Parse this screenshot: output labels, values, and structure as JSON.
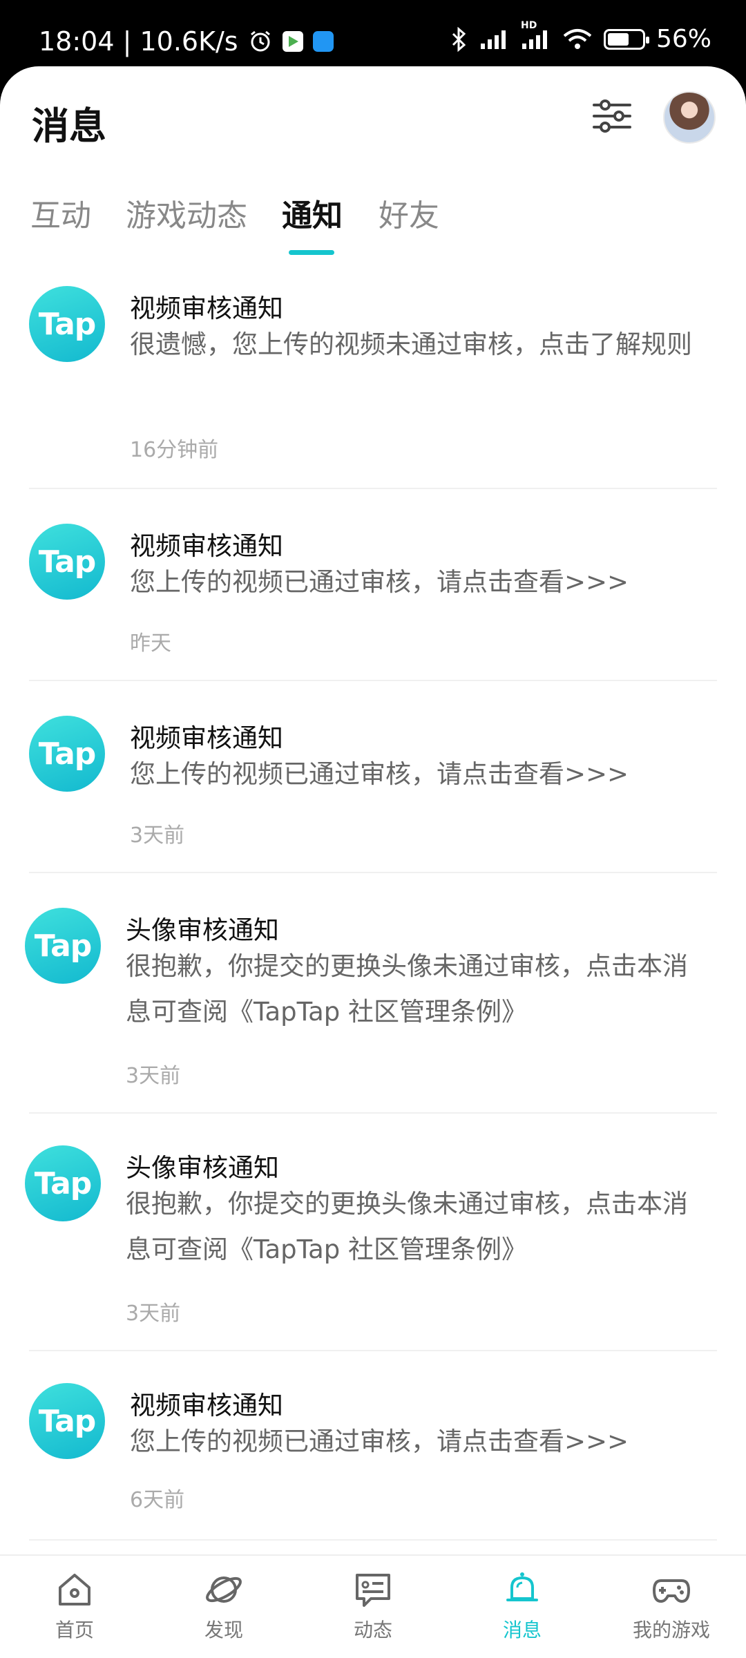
{
  "status_bar": {
    "time_speed": "18:04 | 10.6K/s",
    "network": "HD",
    "battery": "56%"
  },
  "header": {
    "title": "消息"
  },
  "tabs": [
    {
      "label": "互动"
    },
    {
      "label": "游戏动态"
    },
    {
      "label": "通知"
    },
    {
      "label": "好友"
    }
  ],
  "notifications": [
    {
      "logo": "Tap",
      "title": "视频审核通知",
      "body": "很遗憾，您上传的视频未通过审核，点击了解规则",
      "time": "16分钟前"
    },
    {
      "logo": "Tap",
      "title": "视频审核通知",
      "body": "您上传的视频已通过审核，请点击查看>>>",
      "time": "昨天"
    },
    {
      "logo": "Tap",
      "title": "视频审核通知",
      "body": "您上传的视频已通过审核，请点击查看>>>",
      "time": "3天前"
    },
    {
      "logo": "Tap",
      "title": "头像审核通知",
      "body": "很抱歉，你提交的更换头像未通过审核，点击本消息可查阅《TapTap 社区管理条例》",
      "time": "3天前"
    },
    {
      "logo": "Tap",
      "title": "头像审核通知",
      "body": "很抱歉，你提交的更换头像未通过审核，点击本消息可查阅《TapTap 社区管理条例》",
      "time": "3天前"
    },
    {
      "logo": "Tap",
      "title": "视频审核通知",
      "body": "您上传的视频已通过审核，请点击查看>>>",
      "time": "6天前"
    }
  ],
  "bottom_nav": [
    {
      "label": "首页",
      "icon": "home-icon"
    },
    {
      "label": "发现",
      "icon": "planet-icon"
    },
    {
      "label": "动态",
      "icon": "chat-card-icon"
    },
    {
      "label": "消息",
      "icon": "bell-icon"
    },
    {
      "label": "我的游戏",
      "icon": "gamepad-icon"
    }
  ],
  "colors": {
    "accent": "#15c5ce",
    "text_primary": "#111111",
    "text_secondary": "#666666",
    "text_muted": "#aaaaaa"
  }
}
